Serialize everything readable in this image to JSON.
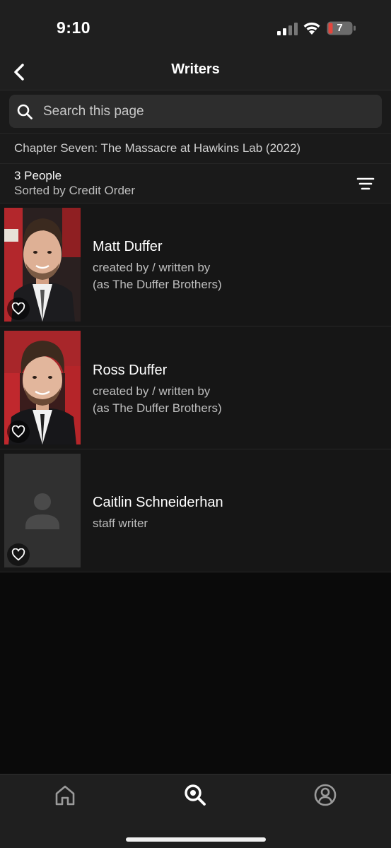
{
  "status_bar": {
    "time": "9:10",
    "battery_level": "7"
  },
  "nav": {
    "title": "Writers",
    "back_icon": "chevron-left-icon"
  },
  "search": {
    "placeholder": "Search this page"
  },
  "context": {
    "title": "Chapter Seven: The Massacre at Hawkins Lab (2022)"
  },
  "summary": {
    "count": "3 People",
    "sort_label": "Sorted by Credit Order"
  },
  "people": [
    {
      "name": "Matt Duffer",
      "role_line1": "created by / written by",
      "role_line2": "(as The Duffer Brothers)",
      "has_photo": true
    },
    {
      "name": "Ross Duffer",
      "role_line1": "created by / written by",
      "role_line2": "(as The Duffer Brothers)",
      "has_photo": true
    },
    {
      "name": "Caitlin Schneiderhan",
      "role_line1": "staff writer",
      "has_photo": false
    }
  ],
  "tabs": [
    {
      "icon": "home-icon",
      "active": false
    },
    {
      "icon": "search-icon",
      "active": true
    },
    {
      "icon": "profile-icon",
      "active": false
    }
  ],
  "colors": {
    "background": "#0a0a0a",
    "bar": "#1f1f1f",
    "accent_red": "#c4242b"
  }
}
